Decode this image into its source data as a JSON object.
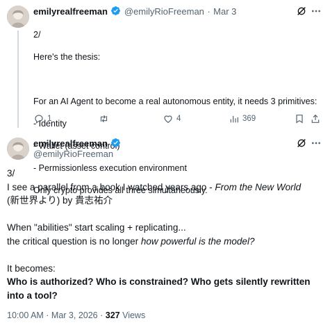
{
  "tweet1": {
    "author_name": "emilyrealfreeman",
    "author_handle": "@emilyRioFreeman",
    "separator": "·",
    "date": "Mar 3",
    "lines": [
      "2/",
      "Here's the thesis:",
      "",
      "For an AI Agent to become a real autonomous entity, it needs 3 primitives:",
      "- Identity",
      "- Wallet (asset control)",
      "- Permissionless execution environment",
      "Only crypto provides all three simultaneously."
    ],
    "actions": {
      "replies": "1",
      "reposts": "",
      "likes": "4",
      "views": "369"
    }
  },
  "tweet2": {
    "author_name": "emilyrealfreeman",
    "author_handle": "@emilyRioFreeman",
    "number": "3/",
    "line1_prefix": "I see a parallel from a book I watched years ago - ",
    "line1_italic": "From the New World",
    "line2": "(新世界より) by 貴志祐介",
    "line3": "When \"abilities\" start scaling + replicating...",
    "line4_prefix": "the critical question is no longer ",
    "line4_italic": "how powerful is the model?",
    "line5": "It becomes:",
    "line6_bold": "Who is authorized? Who is constrained? Who gets silently rewritten into a tool?",
    "timestamp": "10:00 AM · Mar 3, 2026 · ",
    "views_count": "327",
    "views_label": " Views"
  },
  "colors": {
    "text": "#0f1419",
    "secondary": "#536471",
    "verified": "#1d9bf0",
    "thread_line": "#cfd9de"
  },
  "icons": [
    "avatar",
    "verified-badge-icon",
    "grok-icon",
    "more-icon",
    "reply-icon",
    "repost-icon",
    "like-icon",
    "views-icon",
    "bookmark-icon",
    "share-icon"
  ]
}
